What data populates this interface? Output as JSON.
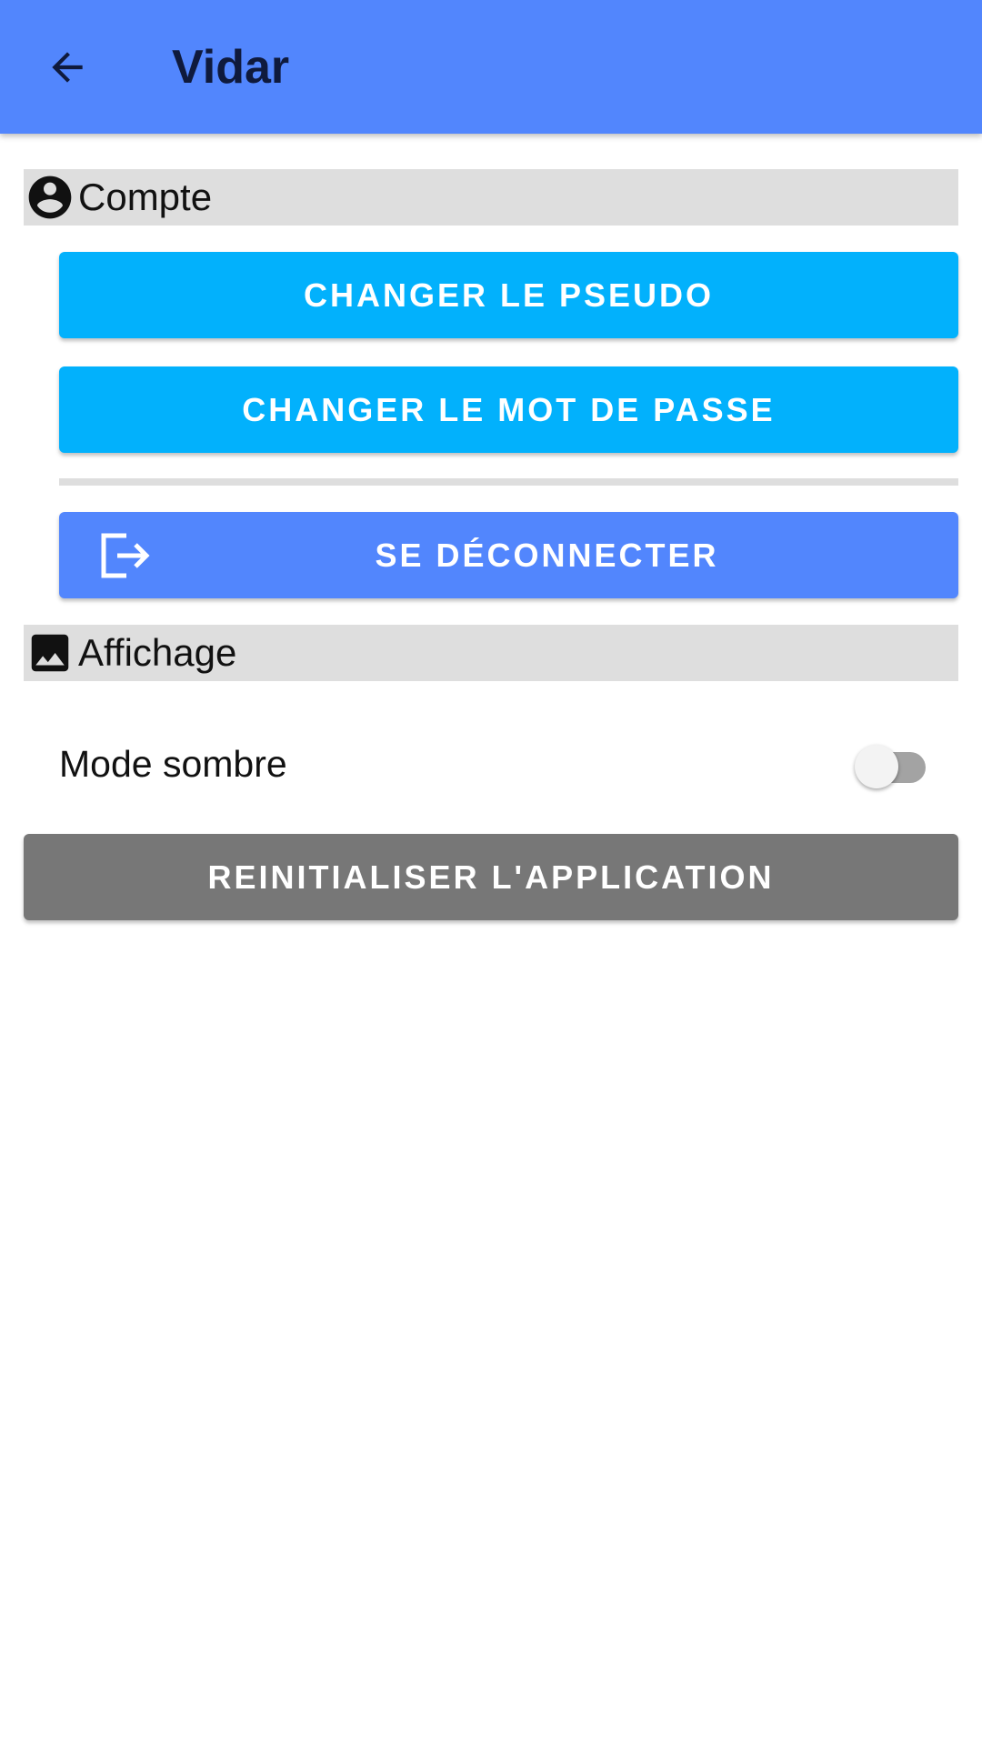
{
  "appbar": {
    "title": "Vidar",
    "back_icon": "arrow-left-icon",
    "background": "#5286fd"
  },
  "account_section": {
    "icon": "account-circle-icon",
    "label": "Compte",
    "change_username_label": "CHANGER LE PSEUDO",
    "change_password_label": "CHANGER LE MOT DE PASSE",
    "logout_icon": "logout-icon",
    "logout_label": "SE DÉCONNECTER"
  },
  "display_section": {
    "icon": "image-icon",
    "label": "Affichage",
    "dark_mode_label": "Mode sombre",
    "dark_mode_enabled": false
  },
  "reset_button_label": "REINITIALISER L'APPLICATION",
  "colors": {
    "primary": "#5286fd",
    "accent": "#02b1fc",
    "section_bg": "#dedede",
    "reset": "#777777"
  }
}
